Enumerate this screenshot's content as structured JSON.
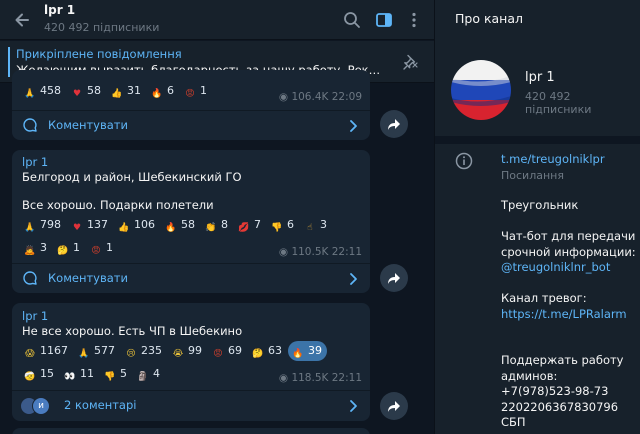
{
  "header": {
    "title": "lpr 1",
    "subtitle": "420 492 підписники"
  },
  "pinned": {
    "title": "Прикріплене повідомлення",
    "text": "Желающим выразить благодарность за нашу работу.  Реквизиты в о..."
  },
  "messages": [
    {
      "reactions": [
        {
          "icon": "folded-hands",
          "emoji_color": "#e0a93b",
          "count": "458"
        },
        {
          "icon": "red-heart",
          "emoji_color": "#e0323a",
          "count": "58"
        },
        {
          "icon": "thumbs-up",
          "emoji_color": "#e0a93b",
          "count": "31"
        },
        {
          "icon": "fire",
          "emoji_color": "#f47a20",
          "count": "6"
        },
        {
          "icon": "angry-face",
          "emoji_color": "#d6402c",
          "count": "1"
        }
      ],
      "views": "106.4K",
      "time": "22:09",
      "comments_label": "Коментувати"
    },
    {
      "author": "lpr 1",
      "lines": [
        "Белгород и район, Шебекинский ГО",
        "",
        "Все хорошо. Подарки полетели"
      ],
      "reactions": [
        {
          "icon": "folded-hands",
          "emoji_color": "#e0a93b",
          "count": "798"
        },
        {
          "icon": "red-heart",
          "emoji_color": "#e0323a",
          "count": "137"
        },
        {
          "icon": "thumbs-up",
          "emoji_color": "#e0a93b",
          "count": "106"
        },
        {
          "icon": "fire",
          "emoji_color": "#f47a20",
          "count": "58"
        },
        {
          "icon": "clapping-hands",
          "emoji_color": "#e0a93b",
          "count": "8"
        },
        {
          "icon": "kiss-mark",
          "emoji_color": "#d83a6a",
          "count": "7"
        },
        {
          "icon": "thumbs-down",
          "emoji_color": "#e0a93b",
          "count": "6"
        },
        {
          "icon": "pointing-hand",
          "emoji_color": "#e0a93b",
          "count": "3"
        },
        {
          "icon": "person-bowing",
          "emoji_color": "#6e9ad3",
          "count": "3"
        },
        {
          "icon": "thinking-face",
          "emoji_color": "#e8c03a",
          "count": "1"
        },
        {
          "icon": "angry-face",
          "emoji_color": "#d6402c",
          "count": "1"
        }
      ],
      "views": "110.5K",
      "time": "22:11",
      "comments_label": "Коментувати"
    },
    {
      "author": "lpr 1",
      "lines": [
        "Не все хорошо. Есть ЧП в Шебекино"
      ],
      "reactions": [
        {
          "icon": "screaming-face",
          "emoji_color": "#e8c03a",
          "count": "1167"
        },
        {
          "icon": "folded-hands",
          "emoji_color": "#e0a93b",
          "count": "577"
        },
        {
          "icon": "crying-face",
          "emoji_color": "#e8c03a",
          "count": "235"
        },
        {
          "icon": "loudly-crying-face",
          "emoji_color": "#e8c03a",
          "count": "99"
        },
        {
          "icon": "angry-face",
          "emoji_color": "#d6402c",
          "count": "69"
        },
        {
          "icon": "thinking-face",
          "emoji_color": "#e8c03a",
          "count": "63"
        },
        {
          "icon": "fire",
          "emoji_color": "#f47a20",
          "count": "39",
          "active": true
        },
        {
          "icon": "face-with-head-bandage",
          "emoji_color": "#e8c03a",
          "count": "15"
        },
        {
          "icon": "eyes",
          "emoji_color": "#f0f0f0",
          "count": "11"
        },
        {
          "icon": "thumbs-down",
          "emoji_color": "#e0a93b",
          "count": "5"
        },
        {
          "icon": "moai",
          "emoji_color": "#9a9a9a",
          "count": "4"
        }
      ],
      "views": "118.5K",
      "time": "22:11",
      "comments_label": "2 коментарі"
    }
  ],
  "info": {
    "title": "Про канал",
    "channel_name": "lpr 1",
    "subscribers": "420 492 підписники",
    "link": "t.me/treugolniklpr",
    "link_label": "Посилання",
    "description": [
      {
        "text": "Треугольник"
      },
      {
        "text": ""
      },
      {
        "text": "Чат-бот для передачи"
      },
      {
        "text": "срочной информации:"
      },
      {
        "text": "@treugolniklnr_bot",
        "link": true
      },
      {
        "text": ""
      },
      {
        "text": "Канал тревог:"
      },
      {
        "text": "https://t.me/LPRalarm",
        "link": true
      },
      {
        "text": ""
      },
      {
        "text": ""
      },
      {
        "text": "Поддержать работу"
      },
      {
        "text": "админов:"
      },
      {
        "text": " +7(978)523-98-73"
      },
      {
        "text": "2202206367830796"
      },
      {
        "text": "СБП"
      }
    ]
  },
  "colors": {
    "accent": "#5eb5f7",
    "background": "#0e1621",
    "panel": "#17212b",
    "bubble": "#182533",
    "reaction_active": "#3c74a8"
  }
}
